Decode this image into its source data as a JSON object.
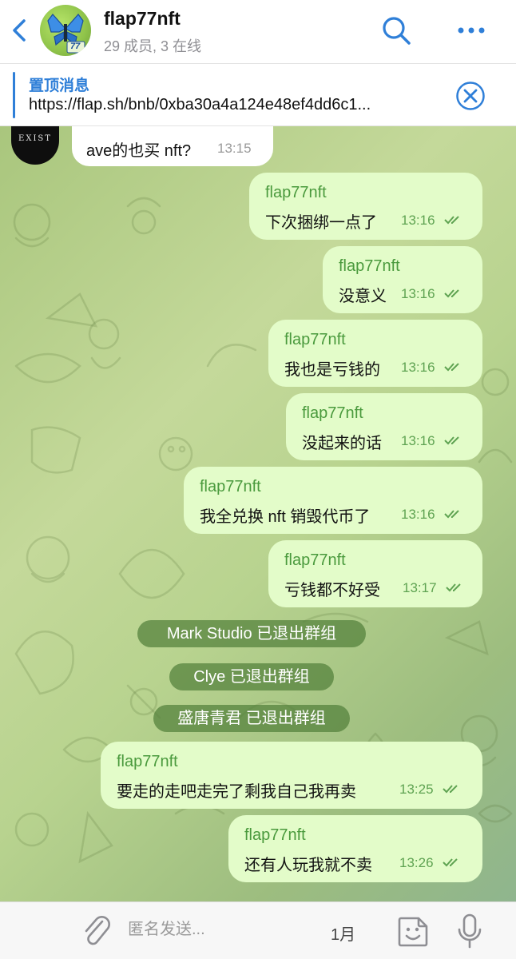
{
  "header": {
    "title": "flap77nft",
    "subtitle": "29 成员, 3 在线",
    "avatar_badge": "77"
  },
  "pinned": {
    "title": "置顶消息",
    "text": "https://flap.sh/bnb/0xba30a4a124e48ef4dd6c1..."
  },
  "chat": {
    "incoming": {
      "avatar_text": "EXIST",
      "text": "ave的也买 nft?",
      "time": "13:15"
    },
    "messages": [
      {
        "sender": "flap77nft",
        "text": "下次捆绑一点了",
        "time": "13:16"
      },
      {
        "sender": "flap77nft",
        "text": "没意义",
        "time": "13:16"
      },
      {
        "sender": "flap77nft",
        "text": "我也是亏钱的",
        "time": "13:16"
      },
      {
        "sender": "flap77nft",
        "text": "没起来的话",
        "time": "13:16"
      },
      {
        "sender": "flap77nft",
        "text": "我全兑换 nft 销毁代币了",
        "time": "13:16"
      },
      {
        "sender": "flap77nft",
        "text": "亏钱都不好受",
        "time": "13:17"
      },
      {
        "sender": "flap77nft",
        "text": "要走的走吧走完了剩我自己我再卖",
        "time": "13:25"
      },
      {
        "sender": "flap77nft",
        "text": "还有人玩我就不卖",
        "time": "13:26"
      }
    ],
    "service": [
      "Mark Studio 已退出群组",
      "Clye 已退出群组",
      "盛唐青君 已退出群组"
    ]
  },
  "input": {
    "placeholder": "匿名发送...",
    "date_label": "1月"
  },
  "colors": {
    "accent": "#2f7fd8",
    "outgoing_bubble": "#e3fcc9",
    "sender_name": "#4a9a3d",
    "service_pill": "#52803a"
  }
}
